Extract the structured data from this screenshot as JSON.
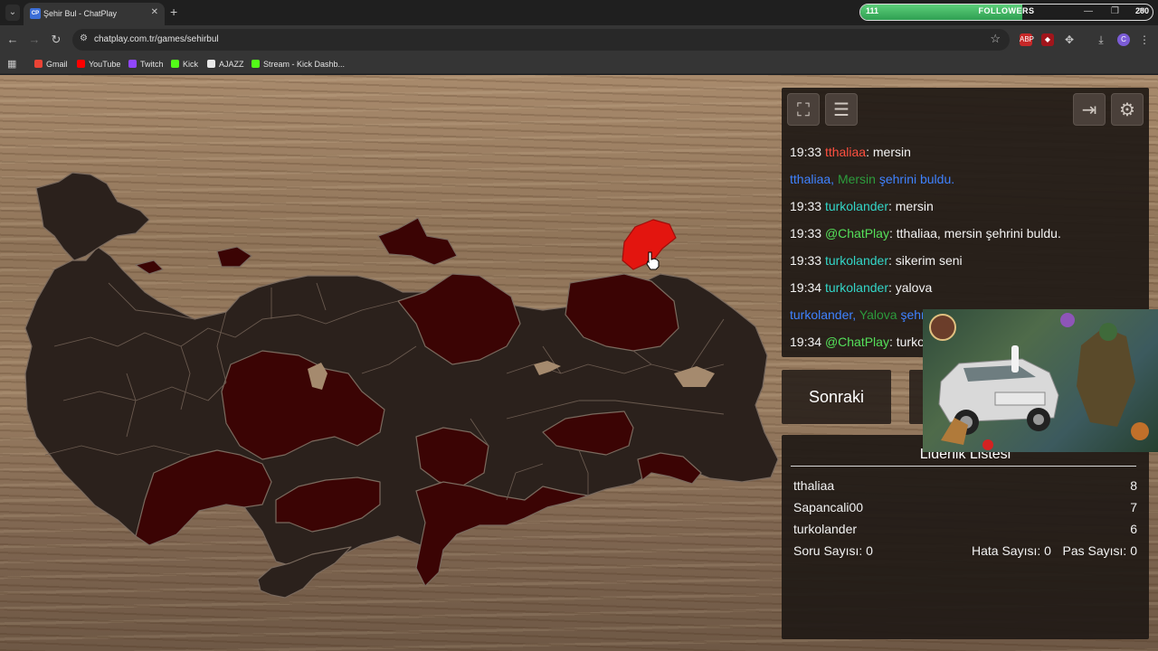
{
  "browser": {
    "tab_title": "Şehir Bul - ChatPlay",
    "tab_favicon_text": "CP",
    "url": "chatplay.com.tr/games/sehirbul",
    "followers_widget": {
      "current": "111",
      "label": "FOLLOWERS",
      "goal": "200",
      "fill_fraction": 0.555,
      "color": "#3fb964"
    },
    "bookmarks": [
      {
        "label": "Gmail",
        "color": "#ea4335"
      },
      {
        "label": "YouTube",
        "color": "#ff0000"
      },
      {
        "label": "Twitch",
        "color": "#9146ff"
      },
      {
        "label": "Kick",
        "color": "#53fc18"
      },
      {
        "label": "AJAZZ",
        "color": "#e8e8e8"
      },
      {
        "label": "Stream - Kick Dashb...",
        "color": "#53fc18"
      }
    ]
  },
  "game": {
    "colors": {
      "province_default": "#2b211c",
      "province_found": "#3b0404",
      "province_highlight": "#e3150f",
      "borders": "#7a6a5e"
    },
    "chat": [
      {
        "time": "19:33",
        "user": "tthaliaa",
        "user_color": "red",
        "text": ": mersin"
      },
      {
        "time": "",
        "user": "tthaliaa,",
        "user_color": "blue",
        "highlight": "Mersin",
        "text": "şehrini buldu."
      },
      {
        "time": "19:33",
        "user": "turkolander",
        "user_color": "teal",
        "text": ": mersin"
      },
      {
        "time": "19:33",
        "user": "@ChatPlay",
        "user_color": "green",
        "text": ": tthaliaa, mersin şehrini buldu."
      },
      {
        "time": "19:33",
        "user": "turkolander",
        "user_color": "teal",
        "text": ": sikerim seni"
      },
      {
        "time": "19:34",
        "user": "turkolander",
        "user_color": "teal",
        "text": ": yalova"
      },
      {
        "time": "",
        "user": "turkolander,",
        "user_color": "blue",
        "highlight": "Yalova",
        "text": "şehr"
      },
      {
        "time": "19:34",
        "user": "@ChatPlay",
        "user_color": "green",
        "text": ": turkol"
      }
    ],
    "next_button": "Sonraki",
    "leaderboard": {
      "title": "Liderlik Listesi",
      "rows": [
        {
          "name": "tthaliaa",
          "score": "8"
        },
        {
          "name": "Sapancali00",
          "score": "7"
        },
        {
          "name": "turkolander",
          "score": "6"
        }
      ],
      "stats": {
        "soru": "Soru Sayısı: 0",
        "hata": "Hata Sayısı: 0",
        "pas": "Pas Sayısı: 0"
      }
    }
  }
}
